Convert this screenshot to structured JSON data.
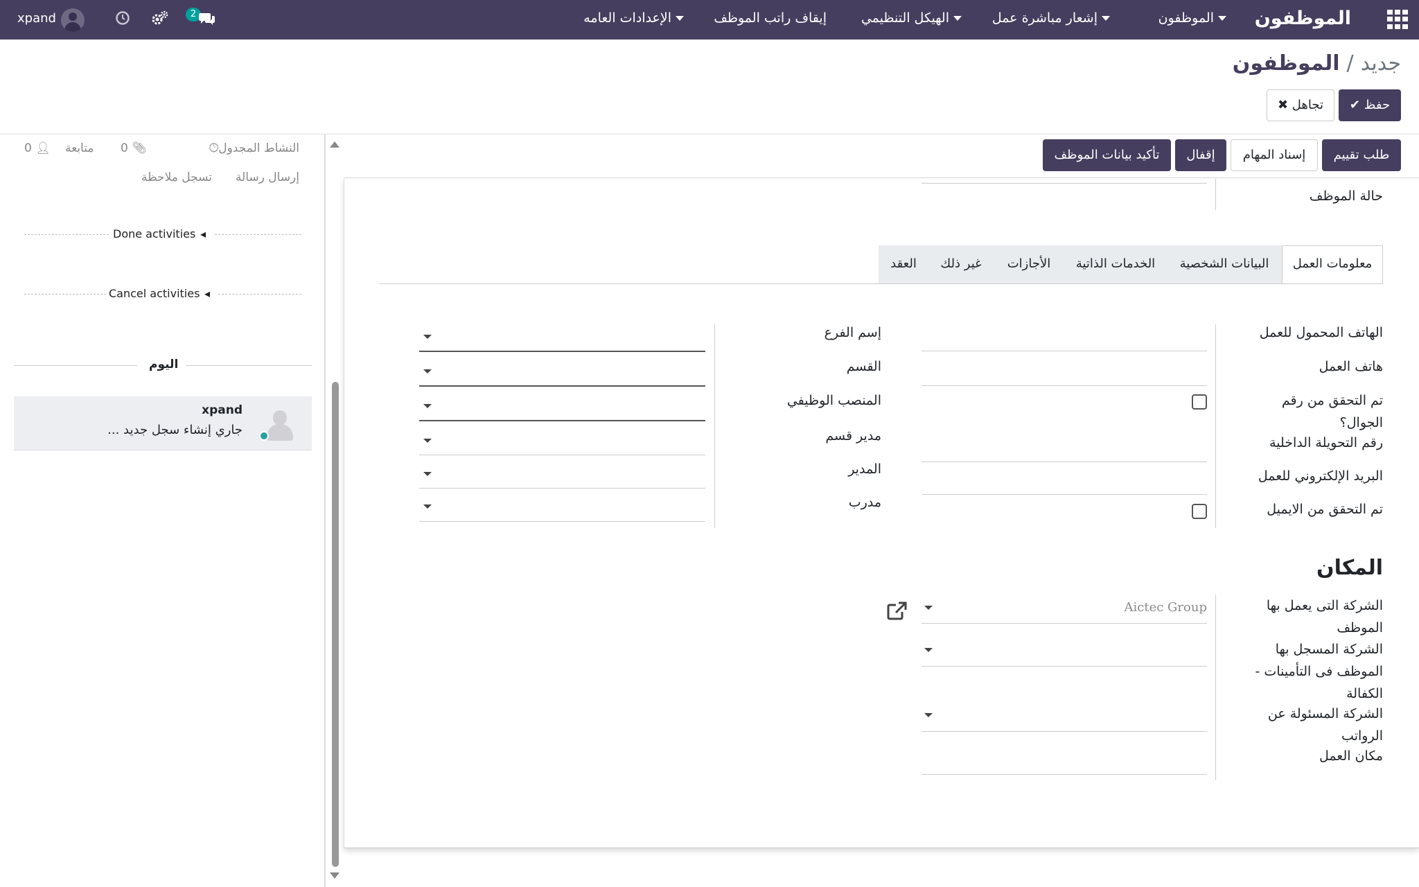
{
  "navbar": {
    "app_name": "الموظفون",
    "menus": [
      {
        "label": "الموظفون"
      },
      {
        "label": "إشعار مباشرة عمل"
      },
      {
        "label": "الهيكل التنظيمي"
      },
      {
        "label": "إيقاف راتب الموظف"
      },
      {
        "label": "الإعدادات العامه"
      }
    ],
    "user_name": "xpand",
    "messages_badge": "2"
  },
  "breadcrumb": {
    "parent": "الموظفون",
    "separator": "/",
    "current": "جديد"
  },
  "actions": {
    "save_label": "حفظ",
    "discard_label": "تجاهل"
  },
  "statusbar": {
    "buttons": [
      "طلب تقييم",
      "إسناد المهام",
      "إقفال",
      "تأكيد بيانات الموظف"
    ]
  },
  "chatter": {
    "scheduled_activity": "النشاط المجدول",
    "attachments_count": "0",
    "follow_label": "متابعة",
    "followers_count": "0",
    "send_message": "إرسال رسالة",
    "log_note": "تسجل ملاحظة",
    "done_activities": "Done activities",
    "cancel_activities": "Cancel activities",
    "today": "اليوم",
    "message": {
      "author": "xpand",
      "body": "جاري إنشاء سجل جديد ..."
    }
  },
  "form": {
    "employee_status_label": "حالة الموظف",
    "tabs": [
      "معلومات العمل",
      "البيانات الشخصية",
      "الخدمات الذاتية",
      "الأجازات",
      "غير ذلك",
      "العقد"
    ],
    "right_fields": [
      "الهاتف المحمول للعمل",
      "هاتف العمل",
      "تم التحقق من رقم الجوال؟",
      "رقم التحويلة الداخلية",
      "البريد الإلكتروني للعمل",
      "تم التحقق من الايميل"
    ],
    "left_fields": [
      "إسم الفرع",
      "القسم",
      "المنصب الوظيفي",
      "مدير قسم",
      "المدير",
      "مدرب"
    ],
    "location_title": "المكان",
    "location_fields": [
      "الشركة التى يعمل بها الموظف",
      "الشركة المسجل بها الموظف فى التأمينات - الكفالة",
      "الشركة المسئولة عن الرواتب",
      "مكان العمل"
    ],
    "company_value": "Aictec Group"
  }
}
